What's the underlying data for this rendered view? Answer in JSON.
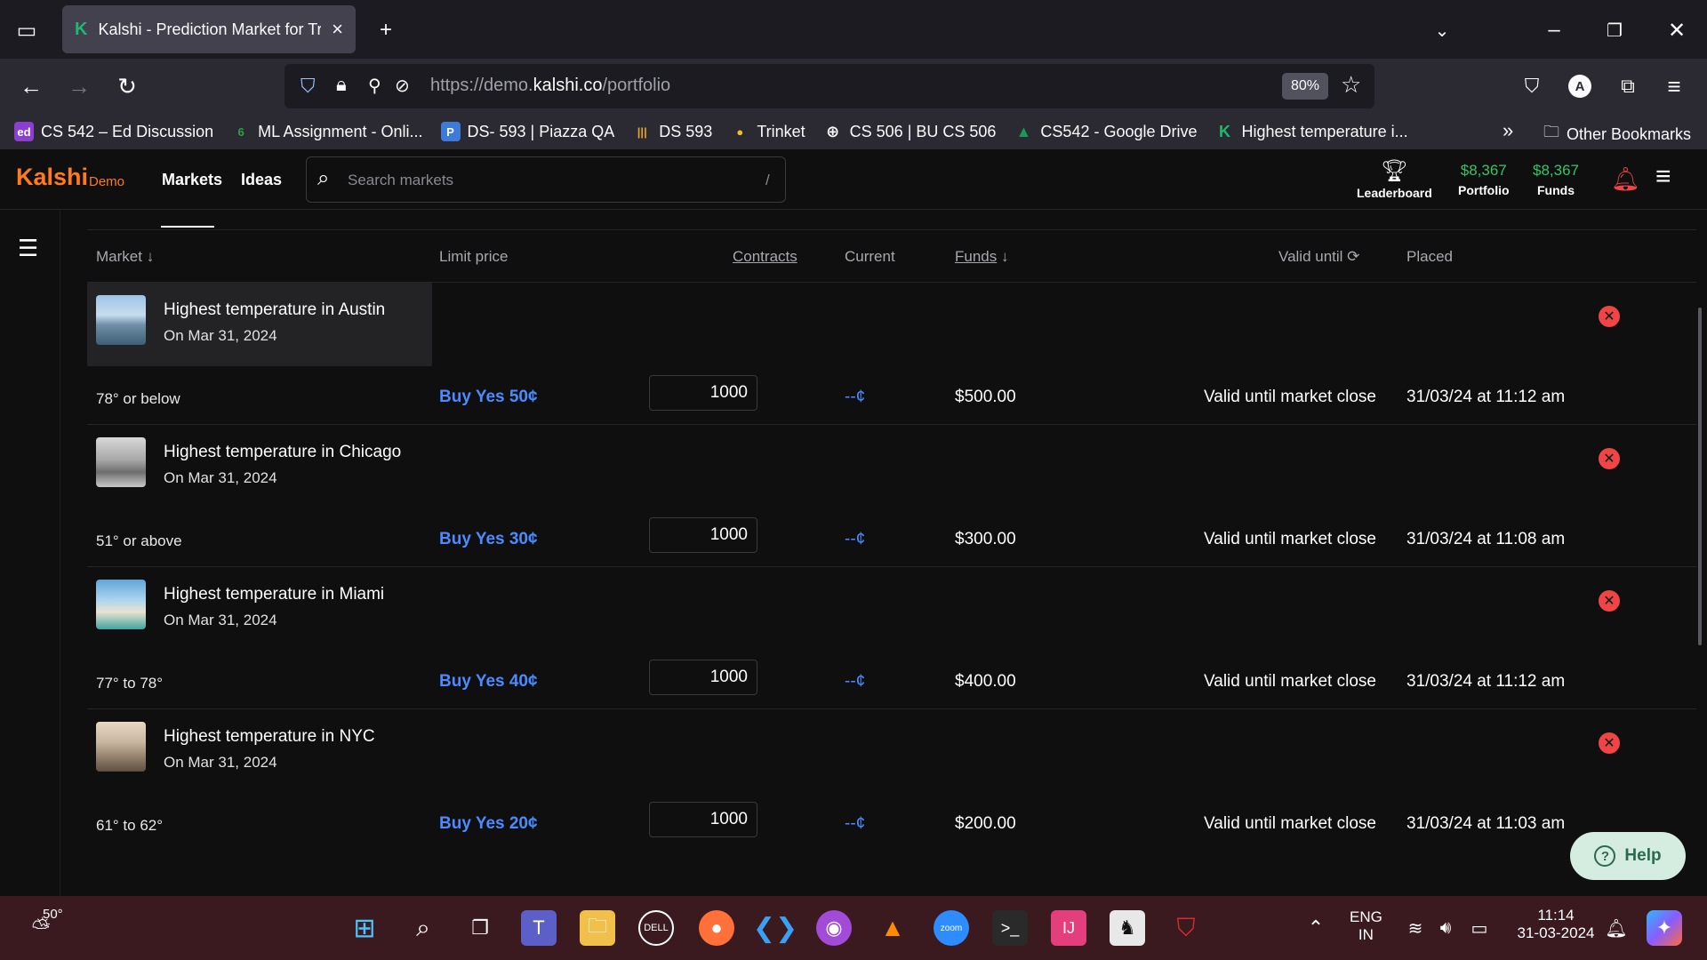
{
  "browser": {
    "tab_title": "Kalshi - Prediction Market for Trading",
    "tab_favicon": "K",
    "url_prefix": "https://demo.",
    "url_domain": "kalshi.co",
    "url_path": "/portfolio",
    "zoom": "80%"
  },
  "bookmarks": [
    {
      "label": "CS 542 – Ed Discussion",
      "icon": "ed",
      "color": "#8a3fd1"
    },
    {
      "label": "ML Assignment - Onli...",
      "icon": "6",
      "color": "#2ea043"
    },
    {
      "label": "DS- 593 | Piazza QA",
      "icon": "P",
      "color": "#3e7bd8"
    },
    {
      "label": "DS 593",
      "icon": "|||",
      "color": "#c0392b"
    },
    {
      "label": "Trinket",
      "icon": "●",
      "color": "#e8c51c"
    },
    {
      "label": "CS 506 | BU CS 506",
      "icon": "⊕",
      "color": "#555"
    },
    {
      "label": "CS542 - Google Drive",
      "icon": "▲",
      "color": "#1a9a52"
    },
    {
      "label": "Highest temperature i...",
      "icon": "K",
      "color": "#1fb86d"
    }
  ],
  "bookmarks_other": "Other Bookmarks",
  "app": {
    "logo": "Kalshi",
    "logo_sub": "Demo",
    "nav": [
      "Markets",
      "Ideas"
    ],
    "search_placeholder": "Search markets",
    "search_shortcut": "/",
    "leaderboard": "Leaderboard",
    "portfolio_amount": "$8,367",
    "portfolio_label": "Portfolio",
    "funds_amount": "$8,367",
    "funds_label": "Funds"
  },
  "table": {
    "headers": {
      "market": "Market",
      "limit_price": "Limit price",
      "contracts": "Contracts",
      "current": "Current",
      "funds": "Funds",
      "valid_until": "Valid until",
      "placed": "Placed"
    },
    "orders": [
      {
        "title": "Highest temperature in Austin",
        "date": "On Mar 31, 2024",
        "outcome": "78° or below",
        "limit": "Buy Yes 50¢",
        "contracts": "1000",
        "current": "--¢",
        "funds": "$500.00",
        "valid": "Valid until market close",
        "placed": "31/03/24 at 11:12 am"
      },
      {
        "title": "Highest temperature in Chicago",
        "date": "On Mar 31, 2024",
        "outcome": "51° or above",
        "limit": "Buy Yes 30¢",
        "contracts": "1000",
        "current": "--¢",
        "funds": "$300.00",
        "valid": "Valid until market close",
        "placed": "31/03/24 at 11:08 am"
      },
      {
        "title": "Highest temperature in Miami",
        "date": "On Mar 31, 2024",
        "outcome": "77° to 78°",
        "limit": "Buy Yes 40¢",
        "contracts": "1000",
        "current": "--¢",
        "funds": "$400.00",
        "valid": "Valid until market close",
        "placed": "31/03/24 at 11:12 am"
      },
      {
        "title": "Highest temperature in NYC",
        "date": "On Mar 31, 2024",
        "outcome": "61° to 62°",
        "limit": "Buy Yes 20¢",
        "contracts": "1000",
        "current": "--¢",
        "funds": "$200.00",
        "valid": "Valid until market close",
        "placed": "31/03/24 at 11:03 am"
      }
    ]
  },
  "help_label": "Help",
  "taskbar": {
    "weather": "50°",
    "lang_top": "ENG",
    "lang_bottom": "IN",
    "time": "11:14",
    "date": "31-03-2024"
  }
}
